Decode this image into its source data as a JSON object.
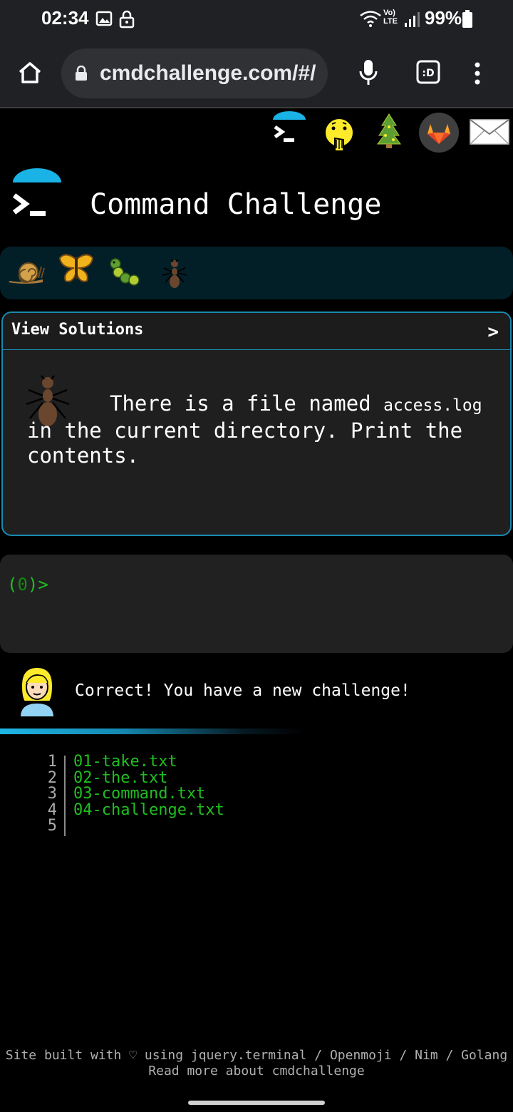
{
  "status_bar": {
    "time": "02:34",
    "battery": "99%",
    "network": "LTE"
  },
  "browser": {
    "url": "cmdchallenge.com/#/"
  },
  "header": {
    "title": "Command Challenge"
  },
  "challenge": {
    "view_solutions": "View Solutions",
    "chevron": ">",
    "text_part1": "There is a file named ",
    "filename": "access.log",
    "text_part2": " in the current directory. Print the contents."
  },
  "terminal": {
    "prompt_open": "(",
    "prompt_count": "0",
    "prompt_close": ")>"
  },
  "feedback": {
    "message": "Correct! You have a new challenge!"
  },
  "output": {
    "line_numbers": [
      "1",
      "2",
      "3",
      "4",
      "5"
    ],
    "lines": [
      "01-take.txt",
      "02-the.txt",
      "03-command.txt",
      "04-challenge.txt",
      ""
    ]
  },
  "footer": {
    "line1": "Site built with ♡ using jquery.terminal / Openmoji / Nim / Golang",
    "line2": "Read more about cmdchallenge"
  },
  "colors": {
    "accent": "#1ab3e6",
    "terminal_green": "#1fbf1f",
    "card_border": "#1a89b1"
  }
}
